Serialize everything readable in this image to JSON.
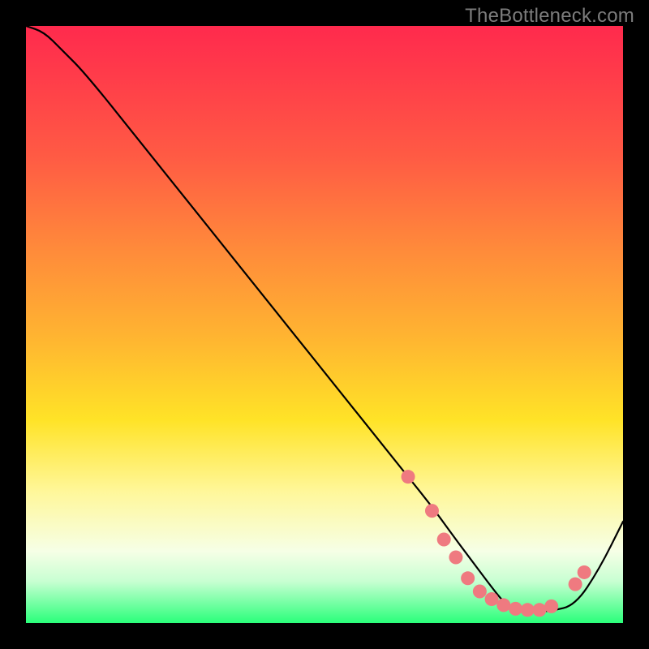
{
  "watermark": "TheBottleneck.com",
  "chart_data": {
    "type": "line",
    "title": "",
    "xlabel": "",
    "ylabel": "",
    "xlim": [
      0,
      100
    ],
    "ylim": [
      0,
      100
    ],
    "series": [
      {
        "name": "bottleneck-curve",
        "x": [
          0,
          3,
          6,
          10,
          20,
          30,
          40,
          50,
          60,
          64,
          68,
          72,
          75,
          78,
          80,
          82,
          84,
          88,
          92,
          96,
          100
        ],
        "y": [
          100,
          99,
          96,
          92,
          79.5,
          67,
          54.5,
          42,
          29.5,
          24.5,
          19.5,
          14,
          10,
          6,
          3.5,
          2.2,
          1.8,
          2.0,
          3.0,
          9,
          17
        ]
      }
    ],
    "markers": {
      "name": "highlight-dots",
      "color": "#ef7a80",
      "points": [
        {
          "x": 64,
          "y": 24.5
        },
        {
          "x": 68,
          "y": 18.8
        },
        {
          "x": 70,
          "y": 14.0
        },
        {
          "x": 72,
          "y": 11.0
        },
        {
          "x": 74,
          "y": 7.5
        },
        {
          "x": 76,
          "y": 5.3
        },
        {
          "x": 78,
          "y": 4.0
        },
        {
          "x": 80,
          "y": 3.0
        },
        {
          "x": 82,
          "y": 2.4
        },
        {
          "x": 84,
          "y": 2.2
        },
        {
          "x": 86,
          "y": 2.2
        },
        {
          "x": 88,
          "y": 2.8
        },
        {
          "x": 92,
          "y": 6.5
        },
        {
          "x": 93.5,
          "y": 8.5
        }
      ]
    },
    "gradient_stops": [
      {
        "pos": 0,
        "color": "#ff2a4d"
      },
      {
        "pos": 8,
        "color": "#ff3b4a"
      },
      {
        "pos": 22,
        "color": "#ff5b44"
      },
      {
        "pos": 38,
        "color": "#ff8c3a"
      },
      {
        "pos": 52,
        "color": "#ffb431"
      },
      {
        "pos": 66,
        "color": "#ffe327"
      },
      {
        "pos": 78,
        "color": "#fff79a"
      },
      {
        "pos": 88,
        "color": "#f6ffe6"
      },
      {
        "pos": 93,
        "color": "#c8ffd2"
      },
      {
        "pos": 100,
        "color": "#2aff7a"
      }
    ]
  }
}
